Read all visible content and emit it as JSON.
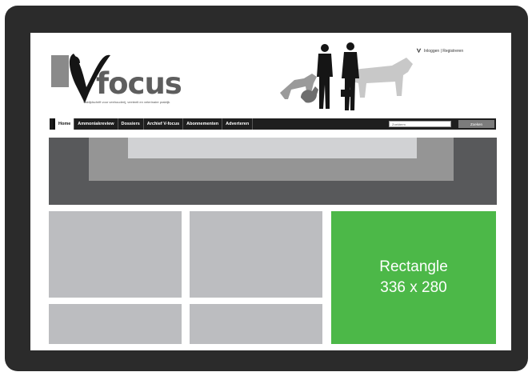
{
  "site": {
    "logo_letter": "V",
    "logo_text": "focus",
    "tagline": "Vaktijdschrift voor veehouderij, veeteelt en veterinaire praktijk"
  },
  "header": {
    "login_text": "Inloggen | Registreren"
  },
  "nav": {
    "items": [
      "Home",
      "Ammoniakreview",
      "Dossiers",
      "Archief V-focus",
      "Abonnementen",
      "Adverteren"
    ],
    "search_placeholder": "Zoekterm",
    "search_button": "Zoeken"
  },
  "ad": {
    "line1": "Rectangle",
    "line2": "336 x 280",
    "color": "#4cb848"
  },
  "colors": {
    "frame": "#2b2b2b",
    "banner_dark": "#58595b",
    "banner_mid": "#959595",
    "banner_light": "#d1d2d4",
    "tile": "#bcbdc0"
  }
}
